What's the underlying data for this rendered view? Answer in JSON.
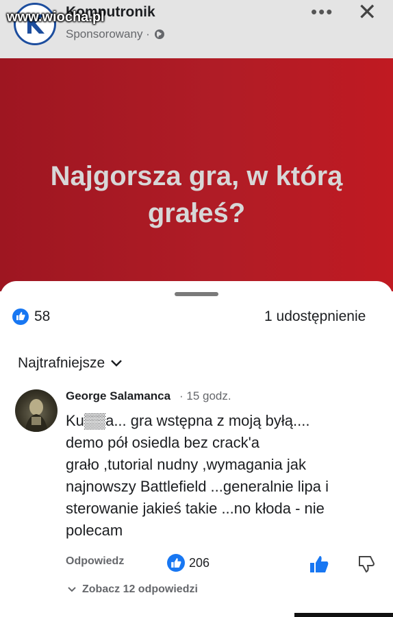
{
  "header": {
    "page_name": "Komputronik",
    "sponsored_label": "Sponsorowany ·",
    "watermark": "www.wiocha.pl",
    "more_glyph": "•••",
    "close_glyph": "✕"
  },
  "banner": {
    "line1": "Najgorsza gra, w którą",
    "line2": "grałeś?",
    "background_color": "#b01c26"
  },
  "stats": {
    "likes": "58",
    "shares": "1 udostępnienie"
  },
  "sort": {
    "label": "Najtrafniejsze",
    "icon": "chevron-down-icon"
  },
  "comment": {
    "author": "George Salamanca",
    "time": "· 15 godz.",
    "lines": [
      "Ku▒▒a... gra wstępna z moją byłą....",
      "demo pół osiedla bez crack'a",
      "grało ,tutorial nudny ,wymagania jak",
      "najnowszy Battlefield ...generalnie lipa i",
      "sterowanie jakieś takie ...no kłoda - nie",
      "polecam"
    ],
    "reply_label": "Odpowiedz",
    "reaction_count": "206",
    "see_replies": "Zobacz 12 odpowiedzi"
  },
  "colors": {
    "accent": "#1877f2",
    "header_bg": "#e4e4e4",
    "banner_red": "#b01c26"
  }
}
